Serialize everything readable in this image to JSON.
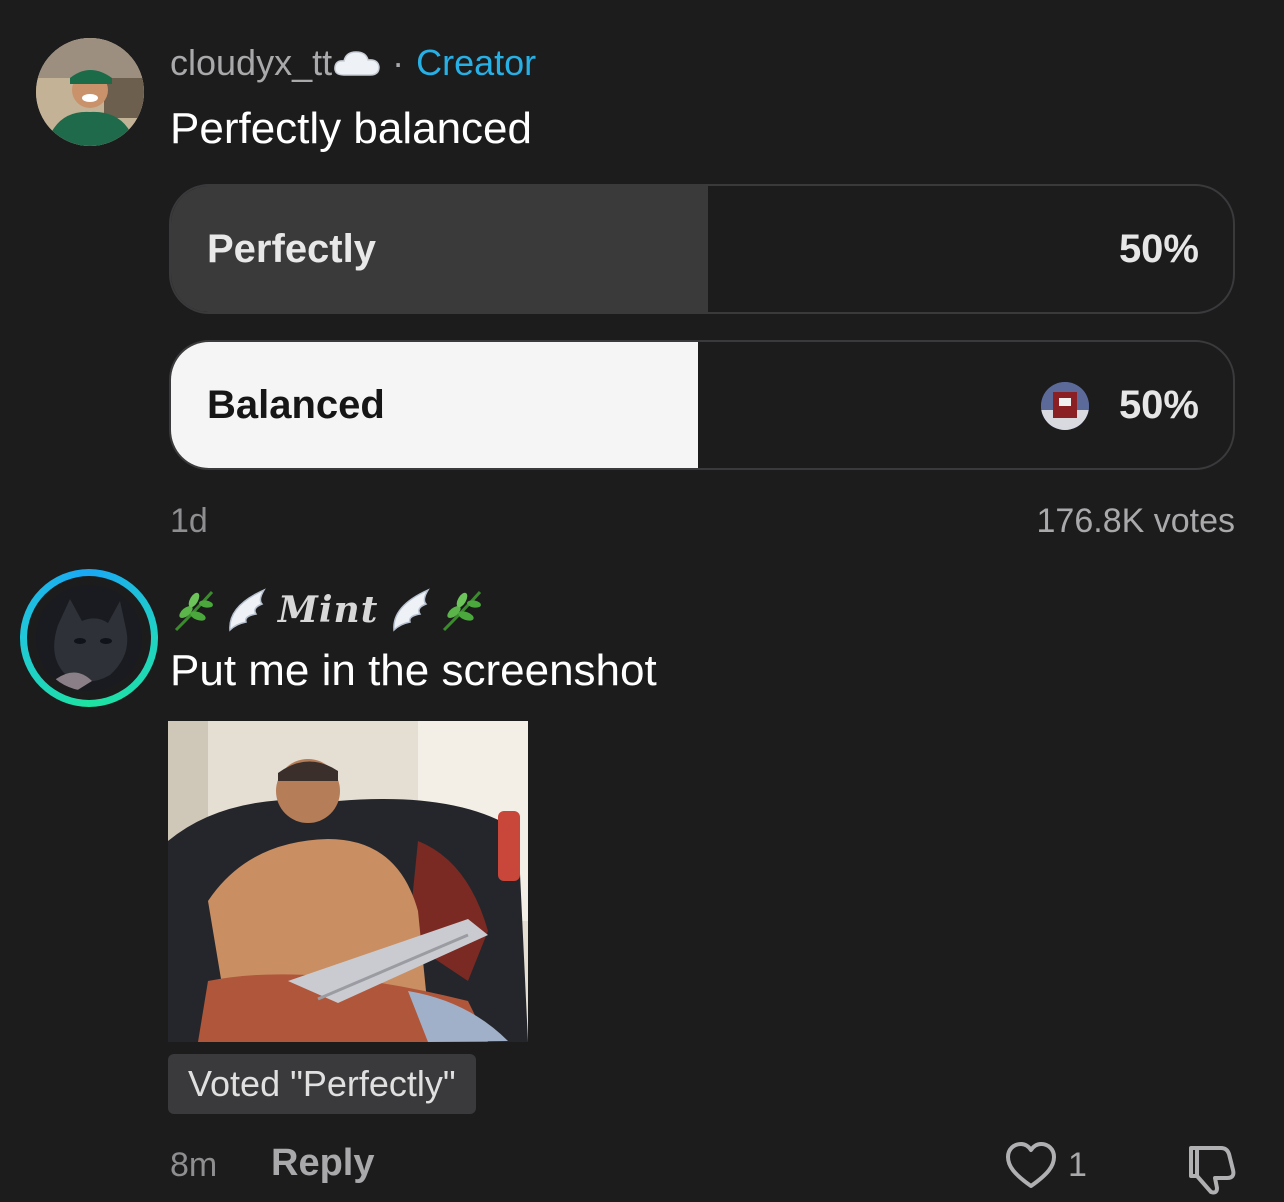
{
  "poll_post": {
    "username": "cloudyx_tt",
    "username_emoji": "☁️",
    "separator": "·",
    "role_badge": "Creator",
    "title": "Perfectly balanced",
    "options": [
      {
        "label": "Perfectly",
        "percent_label": "50%",
        "fill_fraction": 0.5
      },
      {
        "label": "Balanced",
        "percent_label": "50%",
        "fill_fraction": 0.5,
        "selected": true
      }
    ],
    "age": "1d",
    "votes": "176.8K votes"
  },
  "reply_comment": {
    "display_name": "Mint",
    "name_decorations": [
      "herb-icon",
      "wing-icon",
      "wing-icon",
      "herb-icon"
    ],
    "text": "Put me in the screenshot",
    "voted_badge": "Voted \"Perfectly\"",
    "age": "8m",
    "reply_label": "Reply",
    "like_count": "1"
  },
  "colors": {
    "background": "#1c1c1d",
    "creator_accent": "#27b0e6",
    "selected_fill": "#f5f5f5",
    "unselected_fill": "#3a3a3b",
    "muted_text": "#a9a9ab"
  }
}
